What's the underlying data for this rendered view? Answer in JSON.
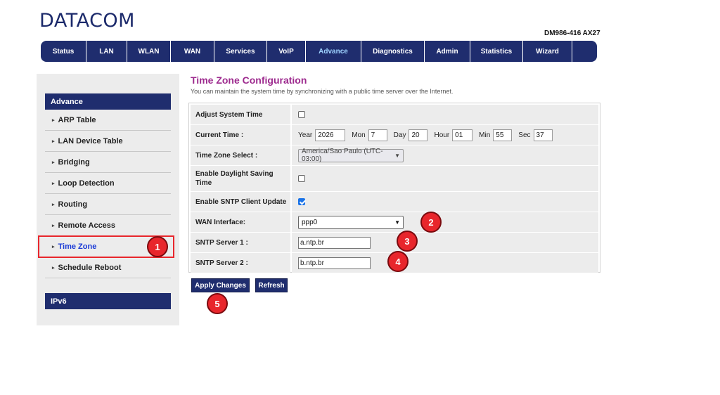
{
  "brand": {
    "logo_text": "DATACOM",
    "model": "DM986-416 AX27"
  },
  "nav": {
    "items": [
      "Status",
      "LAN",
      "WLAN",
      "WAN",
      "Services",
      "VoIP",
      "Advance",
      "Diagnostics",
      "Admin",
      "Statistics",
      "Wizard"
    ],
    "active": "Advance"
  },
  "sidebar": {
    "section_advance": "Advance",
    "items": [
      "ARP Table",
      "LAN Device Table",
      "Bridging",
      "Loop Detection",
      "Routing",
      "Remote Access",
      "Time Zone",
      "Schedule Reboot"
    ],
    "active": "Time Zone",
    "section_ipv6": "IPv6"
  },
  "main": {
    "title": "Time Zone Configuration",
    "description": "You can maintain the system time by synchronizing with a public time server over the Internet."
  },
  "form": {
    "adjust_system_time": {
      "label": "Adjust System Time",
      "checked": false
    },
    "current_time": {
      "label": "Current Time :",
      "year_label": "Year",
      "year": "2026",
      "mon_label": "Mon",
      "mon": "7",
      "day_label": "Day",
      "day": "20",
      "hour_label": "Hour",
      "hour": "01",
      "min_label": "Min",
      "min": "55",
      "sec_label": "Sec",
      "sec": "37"
    },
    "time_zone_select": {
      "label": "Time Zone Select :",
      "value": "America/Sao Paulo (UTC-03:00)"
    },
    "daylight_saving": {
      "label": "Enable Daylight Saving Time",
      "checked": false
    },
    "sntp_client": {
      "label": "Enable SNTP Client Update",
      "checked": true
    },
    "wan_interface": {
      "label": "WAN Interface:",
      "value": "ppp0"
    },
    "sntp_server1": {
      "label": "SNTP Server 1 :",
      "value": "a.ntp.br"
    },
    "sntp_server2": {
      "label": "SNTP Server 2 :",
      "value": "b.ntp.br"
    }
  },
  "buttons": {
    "apply": "Apply Changes",
    "refresh": "Refresh"
  },
  "markers": [
    "1",
    "2",
    "3",
    "4",
    "5"
  ],
  "colors": {
    "nav_bg": "#1f2d6e",
    "title": "#9d2a8e",
    "marker": "#e8262c",
    "active_link": "#1a3ad6"
  }
}
